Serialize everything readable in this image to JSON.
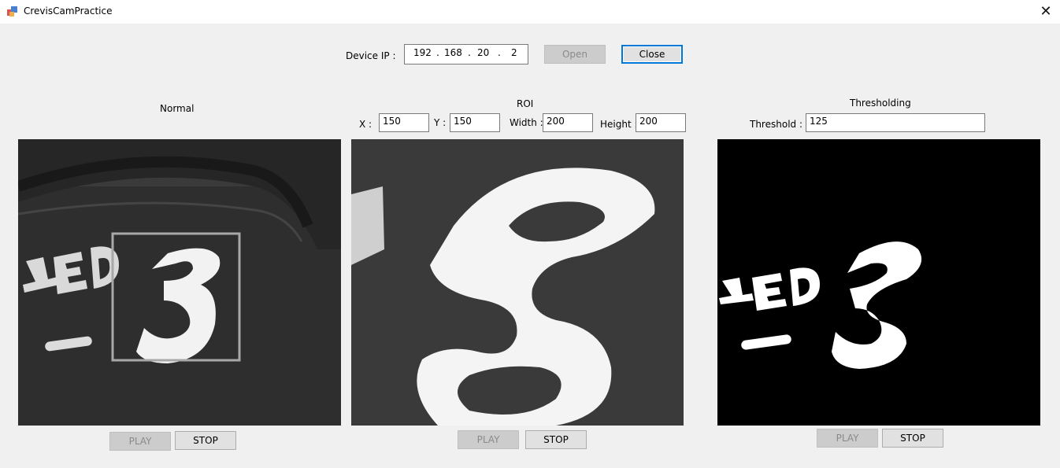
{
  "window": {
    "title": "CrevisCamPractice"
  },
  "device": {
    "label": "Device IP :",
    "ip": [
      "192",
      "168",
      "20",
      "2"
    ],
    "dot": ".",
    "open_label": "Open",
    "close_label": "Close"
  },
  "normal": {
    "title": "Normal",
    "play_label": "PLAY",
    "stop_label": "STOP"
  },
  "roi": {
    "title": "ROI",
    "x_label": "X :",
    "x_value": "150",
    "y_label": "Y :",
    "y_value": "150",
    "width_label": "Width :",
    "width_value": "200",
    "height_label": "Height :",
    "height_value": "200",
    "play_label": "PLAY",
    "stop_label": "STOP"
  },
  "threshold": {
    "title": "Thresholding",
    "threshold_label": "Threshold :",
    "threshold_value": "125",
    "play_label": "PLAY",
    "stop_label": "STOP"
  },
  "icons": [
    "app-icon",
    "close-icon"
  ],
  "colors": {
    "focus_border": "#0078d7",
    "window_bg": "#f0f0f0"
  }
}
